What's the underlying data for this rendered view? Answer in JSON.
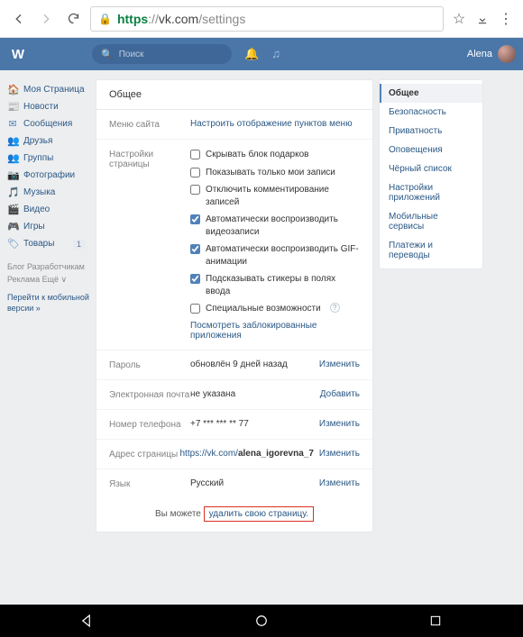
{
  "browser": {
    "url_proto": "https",
    "url_sep": "://",
    "url_host": "vk.com",
    "url_path": "/settings"
  },
  "header": {
    "search_placeholder": "Поиск",
    "username": "Alena"
  },
  "leftnav": {
    "items": [
      {
        "label": "Моя Страница",
        "icon": "🏠"
      },
      {
        "label": "Новости",
        "icon": "📰"
      },
      {
        "label": "Сообщения",
        "icon": "✉"
      },
      {
        "label": "Друзья",
        "icon": "👥"
      },
      {
        "label": "Группы",
        "icon": "👥"
      },
      {
        "label": "Фотографии",
        "icon": "📷"
      },
      {
        "label": "Музыка",
        "icon": "🎵"
      },
      {
        "label": "Видео",
        "icon": "🎬"
      },
      {
        "label": "Игры",
        "icon": "🎮"
      },
      {
        "label": "Товары",
        "icon": "🏷",
        "badge": "1"
      }
    ],
    "footer1": "Блог  Разработчикам",
    "footer2": "Реклама  Ещё ∨",
    "mobile": "Перейти к мобильной версии »"
  },
  "settings": {
    "title": "Общее",
    "menu": {
      "label": "Меню сайта",
      "link": "Настроить отображение пунктов меню"
    },
    "page": {
      "label": "Настройки страницы",
      "opt1": "Скрывать блок подарков",
      "opt2": "Показывать только мои записи",
      "opt3": "Отключить комментирование записей",
      "opt4": "Автоматически воспроизводить видеозаписи",
      "opt5": "Автоматически воспроизводить GIF-анимации",
      "opt6": "Подсказывать стикеры в полях ввода",
      "opt7": "Специальные возможности",
      "blocked": "Посмотреть заблокированные приложения"
    },
    "password": {
      "label": "Пароль",
      "value": "обновлён 9 дней назад",
      "action": "Изменить"
    },
    "email": {
      "label": "Электронная почта",
      "value": "не указана",
      "action": "Добавить"
    },
    "phone": {
      "label": "Номер телефона",
      "value": "+7 *** *** ** 77",
      "action": "Изменить"
    },
    "address": {
      "label": "Адрес страницы",
      "prefix": "https://vk.com/",
      "value": "alena_igorevna_7",
      "action": "Изменить"
    },
    "lang": {
      "label": "Язык",
      "value": "Русский",
      "action": "Изменить"
    },
    "delete": {
      "prefix": "Вы можете ",
      "link": "удалить свою страницу."
    }
  },
  "sidemenu": [
    "Общее",
    "Безопасность",
    "Приватность",
    "Оповещения",
    "Чёрный список",
    "Настройки приложений",
    "Мобильные сервисы",
    "Платежи и переводы"
  ]
}
